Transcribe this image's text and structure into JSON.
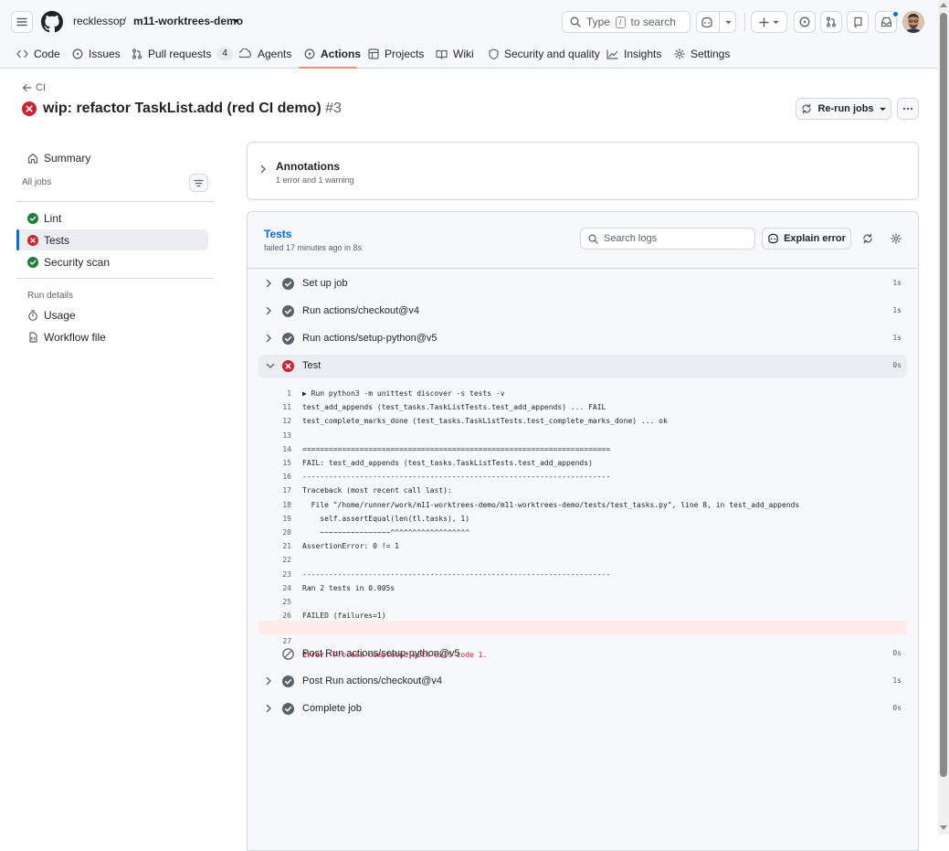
{
  "header": {
    "owner": "recklessop",
    "separator": "/",
    "repo": "m11-worktrees-demo",
    "search_pre": "Type",
    "search_key": "/",
    "search_post": "to search"
  },
  "repo_nav": {
    "code": "Code",
    "issues": "Issues",
    "pull_requests": "Pull requests",
    "pull_requests_count": "4",
    "agents": "Agents",
    "actions": "Actions",
    "projects": "Projects",
    "wiki": "Wiki",
    "security": "Security and quality",
    "insights": "Insights",
    "settings": "Settings"
  },
  "run": {
    "back_label": "CI",
    "title": "wip: refactor TaskList.add (red CI demo)",
    "number": "#3",
    "rerun_label": "Re-run jobs"
  },
  "sidebar": {
    "summary": "Summary",
    "all_jobs": "All jobs",
    "jobs": {
      "lint": "Lint",
      "tests": "Tests",
      "security_scan": "Security scan"
    },
    "run_details": "Run details",
    "usage": "Usage",
    "workflow_file": "Workflow file"
  },
  "annotations": {
    "title": "Annotations",
    "summary": "1 error and 1 warning"
  },
  "job": {
    "name": "Tests",
    "status": "failed 17 minutes ago in 8s",
    "search_placeholder": "Search logs",
    "explain_label": "Explain error"
  },
  "steps": {
    "setup_job": {
      "name": "Set up job",
      "time": "1s"
    },
    "checkout": {
      "name": "Run actions/checkout@v4",
      "time": "1s"
    },
    "setup_python": {
      "name": "Run actions/setup-python@v5",
      "time": "1s"
    },
    "test": {
      "name": "Test",
      "time": "0s"
    },
    "post_setup_python": {
      "name": "Post Run actions/setup-python@v5",
      "time": "0s"
    },
    "post_checkout": {
      "name": "Post Run actions/checkout@v4",
      "time": "1s"
    },
    "complete_job": {
      "name": "Complete job",
      "time": "0s"
    }
  },
  "log": {
    "lines": [
      {
        "n": "1",
        "t": "▶ Run python3 -m unittest discover -s tests -v"
      },
      {
        "n": "11",
        "t": "test_add_appends (test_tasks.TaskListTests.test_add_appends) ... FAIL"
      },
      {
        "n": "12",
        "t": "test_complete_marks_done (test_tasks.TaskListTests.test_complete_marks_done) ... ok"
      },
      {
        "n": "13",
        "t": ""
      },
      {
        "n": "14",
        "t": "======================================================================"
      },
      {
        "n": "15",
        "t": "FAIL: test_add_appends (test_tasks.TaskListTests.test_add_appends)"
      },
      {
        "n": "16",
        "t": "----------------------------------------------------------------------"
      },
      {
        "n": "17",
        "t": "Traceback (most recent call last):"
      },
      {
        "n": "18",
        "t": "  File \"/home/runner/work/m11-worktrees-demo/m11-worktrees-demo/tests/test_tasks.py\", line 8, in test_add_appends"
      },
      {
        "n": "19",
        "t": "    self.assertEqual(len(tl.tasks), 1)"
      },
      {
        "n": "20",
        "t": "    ~~~~~~~~~~~~~~~~^^^^^^^^^^^^^^^^^^"
      },
      {
        "n": "21",
        "t": "AssertionError: 0 != 1"
      },
      {
        "n": "22",
        "t": ""
      },
      {
        "n": "23",
        "t": "----------------------------------------------------------------------"
      },
      {
        "n": "24",
        "t": "Ran 2 tests in 0.005s"
      },
      {
        "n": "25",
        "t": ""
      },
      {
        "n": "26",
        "t": "FAILED (failures=1)"
      }
    ],
    "error_line": {
      "n": "27",
      "label": "Error:",
      "message": " Process completed with exit code 1."
    }
  },
  "colors": {
    "success": "#1a7f37",
    "failure": "#cf222e",
    "link": "#0969da",
    "neutral": "#59636e"
  }
}
